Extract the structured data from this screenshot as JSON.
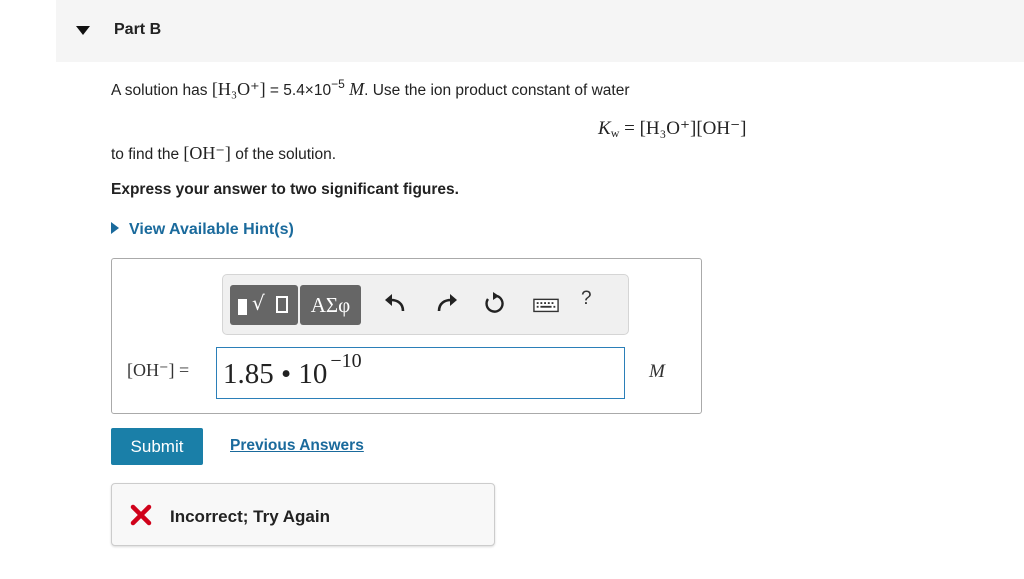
{
  "part": {
    "title": "Part B"
  },
  "problem": {
    "line1_prefix": "A solution has",
    "h3o": "[H₃O⁺]",
    "equals_value": "= 5.4×10",
    "exponent": "−5",
    "unit_m": "M",
    "line1_suffix": ". Use the ion product constant of water",
    "kw_lhs": "K",
    "kw_sub": "w",
    "kw_rhs": "= [H₃O⁺][OH⁻]",
    "line2_prefix": "to find the",
    "oh": "[OH⁻]",
    "line2_suffix": "of the solution.",
    "instruction": "Express your answer to two significant figures."
  },
  "hint": {
    "label": "View Available Hint(s)"
  },
  "toolbar": {
    "templates_icon": "templates-icon",
    "greek_label": "ΑΣφ",
    "undo_icon": "undo-icon",
    "redo_icon": "redo-icon",
    "reset_icon": "reset-icon",
    "keyboard_icon": "keyboard-icon",
    "help_label": "?"
  },
  "answer": {
    "label": "[OH⁻] =",
    "mantissa": "1.85 • 10",
    "exponent": "−10",
    "unit": "M"
  },
  "actions": {
    "submit_label": "Submit",
    "previous_answers_label": "Previous Answers"
  },
  "feedback": {
    "icon": "x-icon",
    "text": "Incorrect; Try Again",
    "color": "#d0021b"
  },
  "colors": {
    "accent": "#1a7fa8",
    "link": "#1a6a9c",
    "header_bg": "#f5f5f5"
  }
}
